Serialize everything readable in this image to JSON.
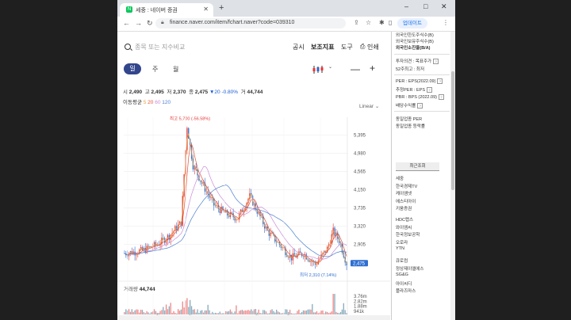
{
  "browser": {
    "tab_title": "세중 : 네이버 증권",
    "favicon": "N",
    "url": "finance.naver.com/item/fchart.naver?code=039310",
    "update_label": "업데이트"
  },
  "toolbar": {
    "search_placeholder": "종목 또는 지수비교",
    "notice": "공시",
    "indicators": "보조지표",
    "tools": "도구",
    "print": "인쇄"
  },
  "periods": [
    "일",
    "주",
    "월"
  ],
  "quote": {
    "open_label": "시",
    "open": "2,490",
    "high_label": "고",
    "high": "2,495",
    "low_label": "저",
    "low": "2,370",
    "close_label": "종",
    "close": "2,475",
    "change": "▼20 -0.80%",
    "volume_label": "거",
    "volume": "44,744"
  },
  "ma": {
    "label": "이동평균",
    "periods": [
      "5",
      "20",
      "60",
      "120"
    ]
  },
  "scale_label": "Linear",
  "chart_data": {
    "type": "candlestick",
    "y_ticks": [
      "5,395",
      "4,980",
      "4,565",
      "4,150",
      "3,735",
      "3,320",
      "2,905"
    ],
    "y_range": [
      2300,
      5800
    ],
    "x_ticks": [
      "2021",
      "4월",
      "8월",
      "2022",
      "4월",
      "8월",
      "2023"
    ],
    "high_marker": "최고 5,700 (-56.58%)",
    "low_marker": "최저 2,310 (7.14%)",
    "last_price": "2,475",
    "volume_label": "거래량",
    "volume_value": "44,744",
    "volume_ticks": [
      "3.76m",
      "2.82m",
      "1.88m",
      "941k"
    ]
  },
  "sidebar": {
    "top_items": [
      "외국인한도주식수(B)",
      "외국인보유주식수(B)",
      "외국인소진율(B/A)"
    ],
    "invest_items": [
      "투자의견 : 목표주가",
      "52주최고 : 최저"
    ],
    "ratio_items": [
      "PER : EPS(2022.09)",
      "추정PER : EPS",
      "PBR : BPS (2022.09)",
      "배당수익률"
    ],
    "sector_items": [
      "동일업종 PER",
      "동일업종 등락률"
    ],
    "recent_tab": "최근조회",
    "recent": [
      "세중",
      "한국경제TV",
      "케이엠넷",
      "에스티아이",
      "키움증권",
      "HDC랩스",
      "와이엠씨",
      "한국정보공학",
      "오로라",
      "YTN",
      "큐로컴",
      "정상제이엘에스",
      "SG&G",
      "아이씨디",
      "플라즈마스"
    ]
  }
}
